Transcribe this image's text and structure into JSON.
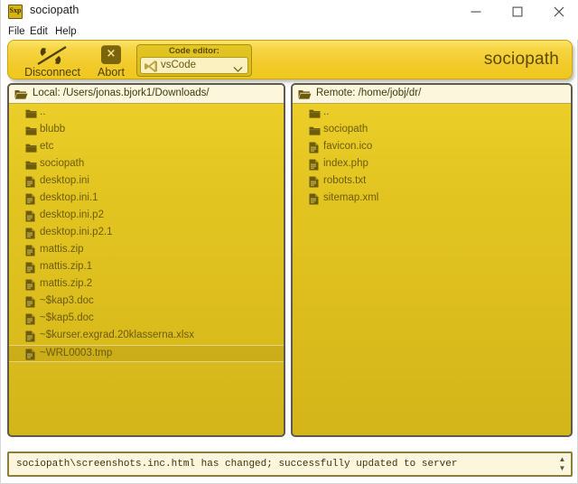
{
  "window": {
    "title": "sociopath",
    "app_icon": "app-icon",
    "controls": {
      "minimize": "minimize-button",
      "maximize": "maximize-button",
      "close": "close-button"
    }
  },
  "menubar": {
    "items": [
      {
        "label": "File"
      },
      {
        "label": "Edit"
      },
      {
        "label": "Help"
      }
    ]
  },
  "toolbar": {
    "disconnect_label": "Disconnect",
    "abort_label": "Abort",
    "abort_glyph": "×",
    "editor_group_label": "Code editor:",
    "editor_selected": "vsCode",
    "wordmark": "sociopath"
  },
  "local_panel": {
    "header": "Local: /Users/jonas.bjork1/Downloads/",
    "files": [
      {
        "name": "..",
        "type": "folder",
        "selected": false
      },
      {
        "name": "blubb",
        "type": "folder",
        "selected": false
      },
      {
        "name": "etc",
        "type": "folder",
        "selected": false
      },
      {
        "name": "sociopath",
        "type": "folder",
        "selected": false
      },
      {
        "name": "desktop.ini",
        "type": "file",
        "selected": false
      },
      {
        "name": "desktop.ini.1",
        "type": "file",
        "selected": false
      },
      {
        "name": "desktop.ini.p2",
        "type": "file",
        "selected": false
      },
      {
        "name": "desktop.ini.p2.1",
        "type": "file",
        "selected": false
      },
      {
        "name": "mattis.zip",
        "type": "file",
        "selected": false
      },
      {
        "name": "mattis.zip.1",
        "type": "file",
        "selected": false
      },
      {
        "name": "mattis.zip.2",
        "type": "file",
        "selected": false
      },
      {
        "name": "~$kap3.doc",
        "type": "file",
        "selected": false
      },
      {
        "name": "~$kap5.doc",
        "type": "file",
        "selected": false
      },
      {
        "name": "~$kurser.exgrad.20klasserna.xlsx",
        "type": "file",
        "selected": false
      },
      {
        "name": "~WRL0003.tmp",
        "type": "file",
        "selected": true
      }
    ]
  },
  "remote_panel": {
    "header": "Remote: /home/jobj/dr/",
    "files": [
      {
        "name": "..",
        "type": "folder",
        "selected": false
      },
      {
        "name": "sociopath",
        "type": "folder",
        "selected": false
      },
      {
        "name": "favicon.ico",
        "type": "file",
        "selected": false
      },
      {
        "name": "index.php",
        "type": "file",
        "selected": false
      },
      {
        "name": "robots.txt",
        "type": "file",
        "selected": false
      },
      {
        "name": "sitemap.xml",
        "type": "file",
        "selected": false
      }
    ]
  },
  "statusbar": {
    "message": "sociopath\\screenshots.inc.html has changed; successfully updated to server"
  },
  "colors": {
    "toolbar_top": "#fce46a",
    "toolbar_bottom": "#efc71f",
    "panel_top": "#edd02a",
    "panel_bottom": "#d4b51a",
    "panel_border": "#5e5a4e",
    "header_bg": "#fcf6dd",
    "text_gold": "#6d5c0c",
    "accent_dark": "#5c4a06"
  }
}
